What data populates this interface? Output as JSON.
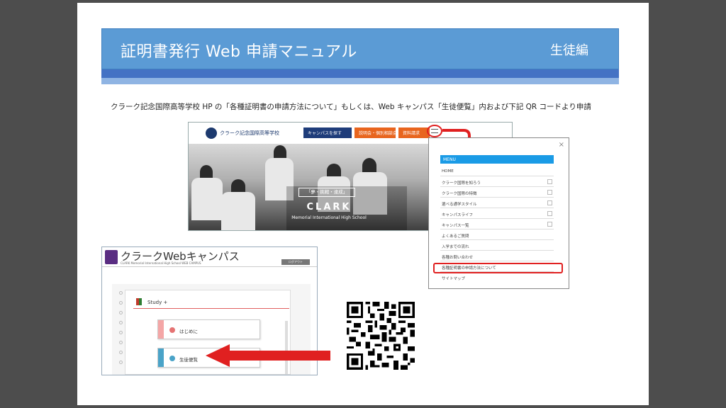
{
  "banner": {
    "title": "証明書発行 Web 申請マニュアル",
    "tag": "生徒編"
  },
  "instruction": "クラーク記念国際高等学校 HP の「各種証明書の申請方法について」もしくは、Web キャンパス「生徒便覧」内および下記 QR コードより申請",
  "site": {
    "logo_text": "クラーク記念国際高等学校",
    "nav": [
      "キャンパスを探す",
      "説明会・個別相談会",
      "資料請求"
    ],
    "slogan": "「夢・挑戦・達成」",
    "brand": "CLARK",
    "brand_sub": "Memorial International High School"
  },
  "menu": {
    "close": "×",
    "header": "MENU",
    "items": [
      "HOME",
      "クラーク国際を知ろう",
      "クラーク国際の特徴",
      "選べる通学スタイル",
      "キャンパスライフ",
      "キャンパス一覧",
      "よくあるご質問",
      "入学までの流れ",
      "各種お問い合わせ",
      "各種証明書の申請方法について",
      "サイトマップ"
    ]
  },
  "campus": {
    "title": "クラークWebキャンパス",
    "subtitle": "CLARK Memorial International High School WEB CAMPUS",
    "logout": "ログアウト",
    "study": "Study +",
    "cards": [
      "はじめに",
      "生徒便覧"
    ]
  },
  "colors": {
    "banner": "#5b9bd5",
    "accent_red": "#e02020",
    "menu_blue": "#1a9be6"
  }
}
